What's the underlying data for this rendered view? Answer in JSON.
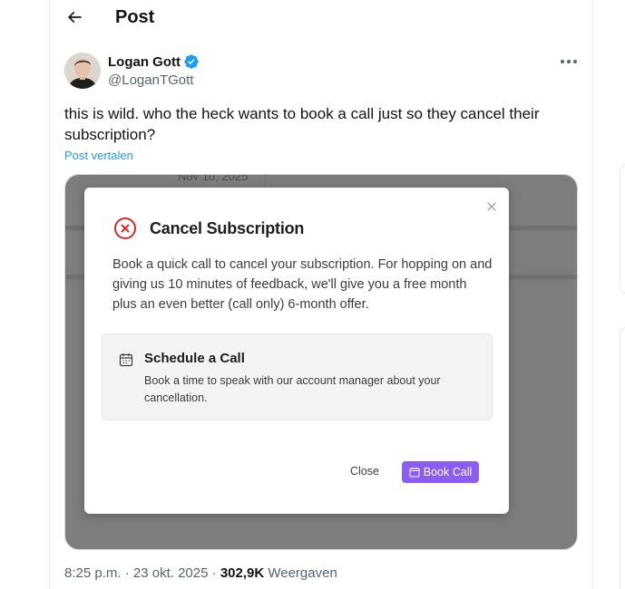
{
  "header": {
    "title": "Post",
    "back_icon": "arrow-left-icon"
  },
  "author": {
    "name": "Logan Gott",
    "handle": "@LoganTGott",
    "verified": true,
    "verified_color": "#1d9bf0"
  },
  "tweet": {
    "text": "this is wild. who the heck wants to book a call just so they cancel their subscription?",
    "translate_label": "Post vertalen"
  },
  "media": {
    "background_date": "Nov 10, 2025",
    "modal": {
      "title": "Cancel Subscription",
      "description": "Book a quick call to cancel your subscription. For hopping on and giving us 10 minutes of feedback, we'll give you a free month plus an even better (call only) 6-month offer.",
      "option": {
        "title": "Schedule a Call",
        "description": "Book a time to speak with our account manager about your cancellation."
      },
      "close_label": "Close",
      "book_label": "Book Call",
      "accent_color": "#8b5cf6",
      "danger_color": "#dc2626"
    }
  },
  "meta": {
    "time": "8:25 p.m.",
    "separator": "·",
    "date": "23 okt. 2025",
    "views_count": "302,9K",
    "views_label": "Weergaven"
  }
}
